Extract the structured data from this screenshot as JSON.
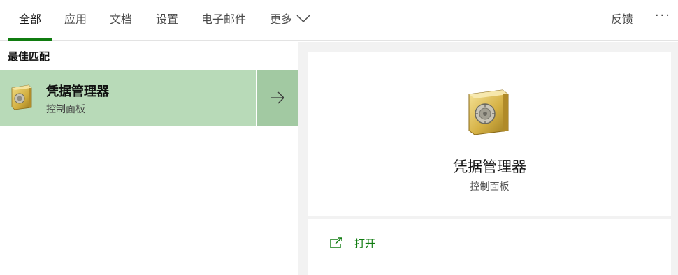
{
  "tabs": [
    {
      "label": "全部"
    },
    {
      "label": "应用"
    },
    {
      "label": "文档"
    },
    {
      "label": "设置"
    },
    {
      "label": "电子邮件"
    },
    {
      "label": "更多"
    }
  ],
  "header": {
    "feedback_label": "反馈",
    "more_options": "···"
  },
  "best_match": {
    "section_title": "最佳匹配",
    "title": "凭据管理器",
    "subtitle": "控制面板"
  },
  "detail": {
    "title": "凭据管理器",
    "subtitle": "控制面板",
    "actions": [
      {
        "label": "打开",
        "icon": "open-external-icon"
      }
    ]
  },
  "colors": {
    "accent": "#107c10",
    "selected_bg": "#b8dab8",
    "selected_arrow_bg": "#a2c9a2"
  }
}
